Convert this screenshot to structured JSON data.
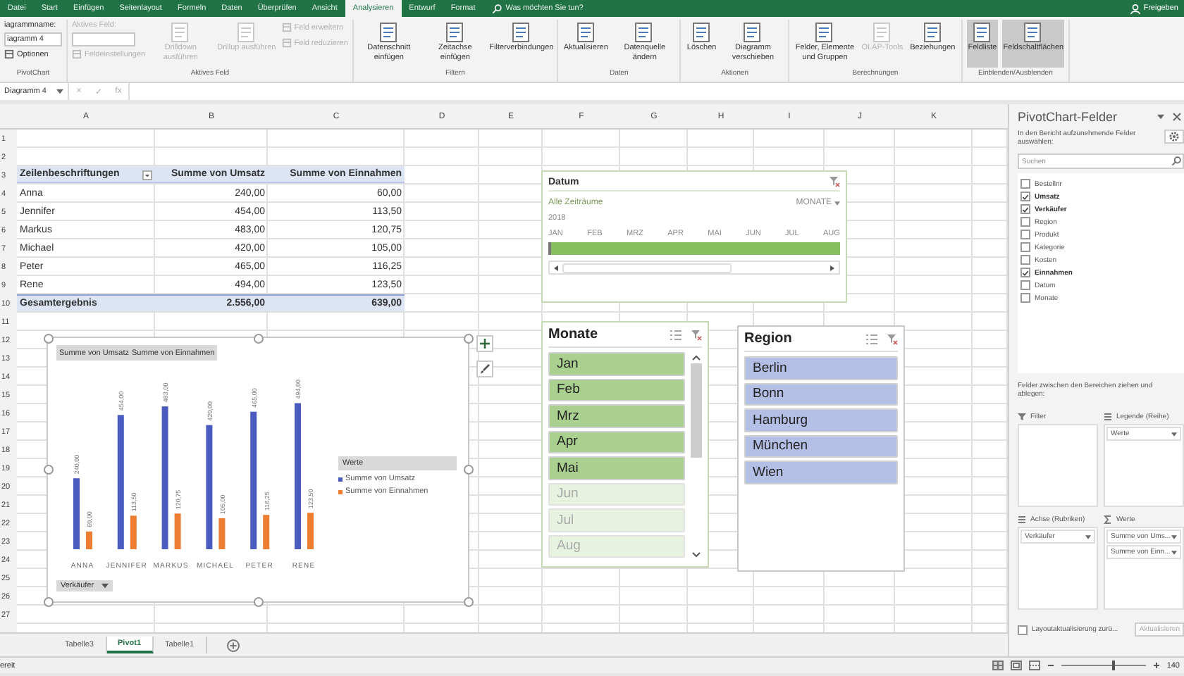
{
  "ribbon_tabs": [
    {
      "label": "Datei",
      "selected": false
    },
    {
      "label": "Start",
      "selected": false
    },
    {
      "label": "Einfügen",
      "selected": false
    },
    {
      "label": "Seitenlayout",
      "selected": false
    },
    {
      "label": "Formeln",
      "selected": false
    },
    {
      "label": "Daten",
      "selected": false
    },
    {
      "label": "Überprüfen",
      "selected": false
    },
    {
      "label": "Ansicht",
      "selected": false
    },
    {
      "label": "Analysieren",
      "selected": true
    },
    {
      "label": "Entwurf",
      "selected": false
    },
    {
      "label": "Format",
      "selected": false
    }
  ],
  "tell_me": "Was möchten Sie tun?",
  "share": "Freigeben",
  "ribbon_groups": [
    {
      "label": "PivotChart",
      "items": [
        {
          "kind": "label",
          "label": "iagrammname:",
          "disabled": false
        },
        {
          "kind": "input",
          "value": "iagramm 4",
          "disabled": false
        },
        {
          "kind": "small",
          "label": "Optionen",
          "disabled": false
        }
      ]
    },
    {
      "label": "Aktives Feld",
      "items": [
        {
          "kind": "label",
          "label": "Aktives Feld:",
          "disabled": true
        },
        {
          "kind": "input",
          "disabled": true
        },
        {
          "kind": "small",
          "label": "Feldeinstellungen",
          "disabled": true
        },
        {
          "kind": "large",
          "label": "Drilldown ausführen",
          "disabled": true,
          "pressed": false
        },
        {
          "kind": "large",
          "label": "Drillup ausführen",
          "disabled": true,
          "pressed": false
        },
        {
          "kind": "small",
          "label": "Feld erweitern",
          "disabled": true
        },
        {
          "kind": "small",
          "label": "Feld reduzieren",
          "disabled": true
        }
      ]
    },
    {
      "label": "Filtern",
      "items": [
        {
          "kind": "large",
          "label": "Datenschnitt einfügen",
          "disabled": false,
          "pressed": false
        },
        {
          "kind": "large",
          "label": "Zeitachse einfügen",
          "disabled": false,
          "pressed": false
        },
        {
          "kind": "large",
          "label": "Filterverbindungen",
          "disabled": false,
          "pressed": false
        }
      ]
    },
    {
      "label": "Daten",
      "items": [
        {
          "kind": "large",
          "label": "Aktualisieren",
          "disabled": false,
          "pressed": false
        },
        {
          "kind": "large",
          "label": "Datenquelle ändern",
          "disabled": false,
          "pressed": false
        }
      ]
    },
    {
      "label": "Aktionen",
      "items": [
        {
          "kind": "large",
          "label": "Löschen",
          "disabled": false,
          "pressed": false
        },
        {
          "kind": "large",
          "label": "Diagramm verschieben",
          "disabled": false,
          "pressed": false
        }
      ]
    },
    {
      "label": "Berechnungen",
      "items": [
        {
          "kind": "large",
          "label": "Felder, Elemente und Gruppen",
          "disabled": false,
          "pressed": false
        },
        {
          "kind": "large",
          "label": "OLAP-Tools",
          "disabled": true,
          "pressed": false
        },
        {
          "kind": "large",
          "label": "Beziehungen",
          "disabled": false,
          "pressed": false
        }
      ]
    },
    {
      "label": "Einblenden/Ausblenden",
      "items": [
        {
          "kind": "large",
          "label": "Feldliste",
          "disabled": false,
          "pressed": true
        },
        {
          "kind": "large",
          "label": "Feldschaltflächen",
          "disabled": false,
          "pressed": true
        }
      ]
    }
  ],
  "formula_bar": {
    "name_box": "Diagramm 4",
    "buttons": [
      "×",
      "✓",
      "fx"
    ]
  },
  "columns": [
    "A",
    "B",
    "C",
    "D",
    "E",
    "F",
    "G",
    "H",
    "I",
    "J",
    "K"
  ],
  "row_numbers": [
    "1",
    "2",
    "3",
    "4",
    "5",
    "6",
    "7",
    "8",
    "9",
    "10",
    "11",
    "12",
    "13",
    "14",
    "15",
    "16",
    "17",
    "18",
    "19",
    "20",
    "21",
    "22",
    "23",
    "24",
    "25",
    "26",
    "27"
  ],
  "pivot_table": {
    "header": [
      "Zeilenbeschriftungen",
      "Summe von Umsatz",
      "Summe von Einnahmen"
    ],
    "rows": [
      [
        "Anna",
        "240,00",
        "60,00"
      ],
      [
        "Jennifer",
        "454,00",
        "113,50"
      ],
      [
        "Markus",
        "483,00",
        "120,75"
      ],
      [
        "Michael",
        "420,00",
        "105,00"
      ],
      [
        "Peter",
        "465,00",
        "116,25"
      ],
      [
        "Rene",
        "494,00",
        "123,50"
      ]
    ],
    "total": [
      "Gesamtergebnis",
      "2.556,00",
      "639,00"
    ]
  },
  "chart": {
    "field_buttons": [
      "Summe von Umsatz",
      "Summe von Einnahmen"
    ],
    "legend_title": "Werte",
    "axis_button": "Verkäufer",
    "chart_data": {
      "type": "bar",
      "categories": [
        "ANNA",
        "JENNIFER",
        "MARKUS",
        "MICHAEL",
        "PETER",
        "RENE"
      ],
      "series": [
        {
          "name": "Summe von Umsatz",
          "color": "#4a5cc0",
          "values": [
            240,
            454,
            483,
            420,
            465,
            494
          ],
          "value_labels": [
            "240,00",
            "454,00",
            "483,00",
            "420,00",
            "465,00",
            "494,00"
          ]
        },
        {
          "name": "Summe von Einnahmen",
          "color": "#ed7d31",
          "values": [
            60,
            113.5,
            120.75,
            105,
            116.25,
            123.5
          ],
          "value_labels": [
            "60,00",
            "113,50",
            "120,75",
            "105,00",
            "116,25",
            "123,50"
          ]
        }
      ]
    }
  },
  "timeline": {
    "title": "Datum",
    "period": "Alle Zeiträume",
    "level_label": "MONATE",
    "year": "2018",
    "months": [
      "JAN",
      "FEB",
      "MRZ",
      "APR",
      "MAI",
      "JUN",
      "JUL",
      "AUG"
    ]
  },
  "slicers": [
    {
      "title": "Monate",
      "scrollable": true,
      "color": "#a9d08e",
      "items": [
        {
          "label": "Jan",
          "selected": true
        },
        {
          "label": "Feb",
          "selected": true
        },
        {
          "label": "Mrz",
          "selected": true
        },
        {
          "label": "Apr",
          "selected": true
        },
        {
          "label": "Mai",
          "selected": true
        },
        {
          "label": "Jun",
          "selected": false
        },
        {
          "label": "Jul",
          "selected": false
        },
        {
          "label": "Aug",
          "selected": false
        }
      ]
    },
    {
      "title": "Region",
      "scrollable": false,
      "color": "#b4bfe6",
      "items": [
        {
          "label": "Berlin",
          "selected": true
        },
        {
          "label": "Bonn",
          "selected": true
        },
        {
          "label": "Hamburg",
          "selected": true
        },
        {
          "label": "München",
          "selected": true
        },
        {
          "label": "Wien",
          "selected": true
        }
      ]
    }
  ],
  "sheet_tabs": [
    {
      "label": "Tabelle3",
      "selected": false
    },
    {
      "label": "Pivot1",
      "selected": true
    },
    {
      "label": "Tabelle1",
      "selected": false
    }
  ],
  "field_pane": {
    "title": "PivotChart-Felder",
    "subtitle": "In den Bericht aufzunehmende Felder auswählen:",
    "search_placeholder": "Suchen",
    "fields": [
      {
        "label": "Bestellnr",
        "checked": false
      },
      {
        "label": "Umsatz",
        "checked": true
      },
      {
        "label": "Verkäufer",
        "checked": true
      },
      {
        "label": "Region",
        "checked": false
      },
      {
        "label": "Produkt",
        "checked": false
      },
      {
        "label": "Kategorie",
        "checked": false
      },
      {
        "label": "Kosten",
        "checked": false
      },
      {
        "label": "Einnahmen",
        "checked": true
      },
      {
        "label": "Datum",
        "checked": false
      },
      {
        "label": "Monate",
        "checked": false
      }
    ],
    "drag_hint": "Felder zwischen den Bereichen ziehen und ablegen:",
    "areas": [
      {
        "label": "Filter"
      },
      {
        "label": "Legende (Reihe)",
        "items": [
          "Werte"
        ]
      },
      {
        "label": "Achse (Rubriken)",
        "items": [
          "Verkäufer"
        ]
      },
      {
        "label": "Werte",
        "items": [
          "Summe von Ums...",
          "Summe von Einn..."
        ]
      }
    ],
    "defer_update": {
      "label": "Layoutaktualisierung zurü...",
      "checked": false
    },
    "update_button": "Aktualisieren"
  },
  "status_bar": {
    "text": "ereit",
    "zoom": {
      "level": 0.62,
      "reading": "140"
    }
  }
}
